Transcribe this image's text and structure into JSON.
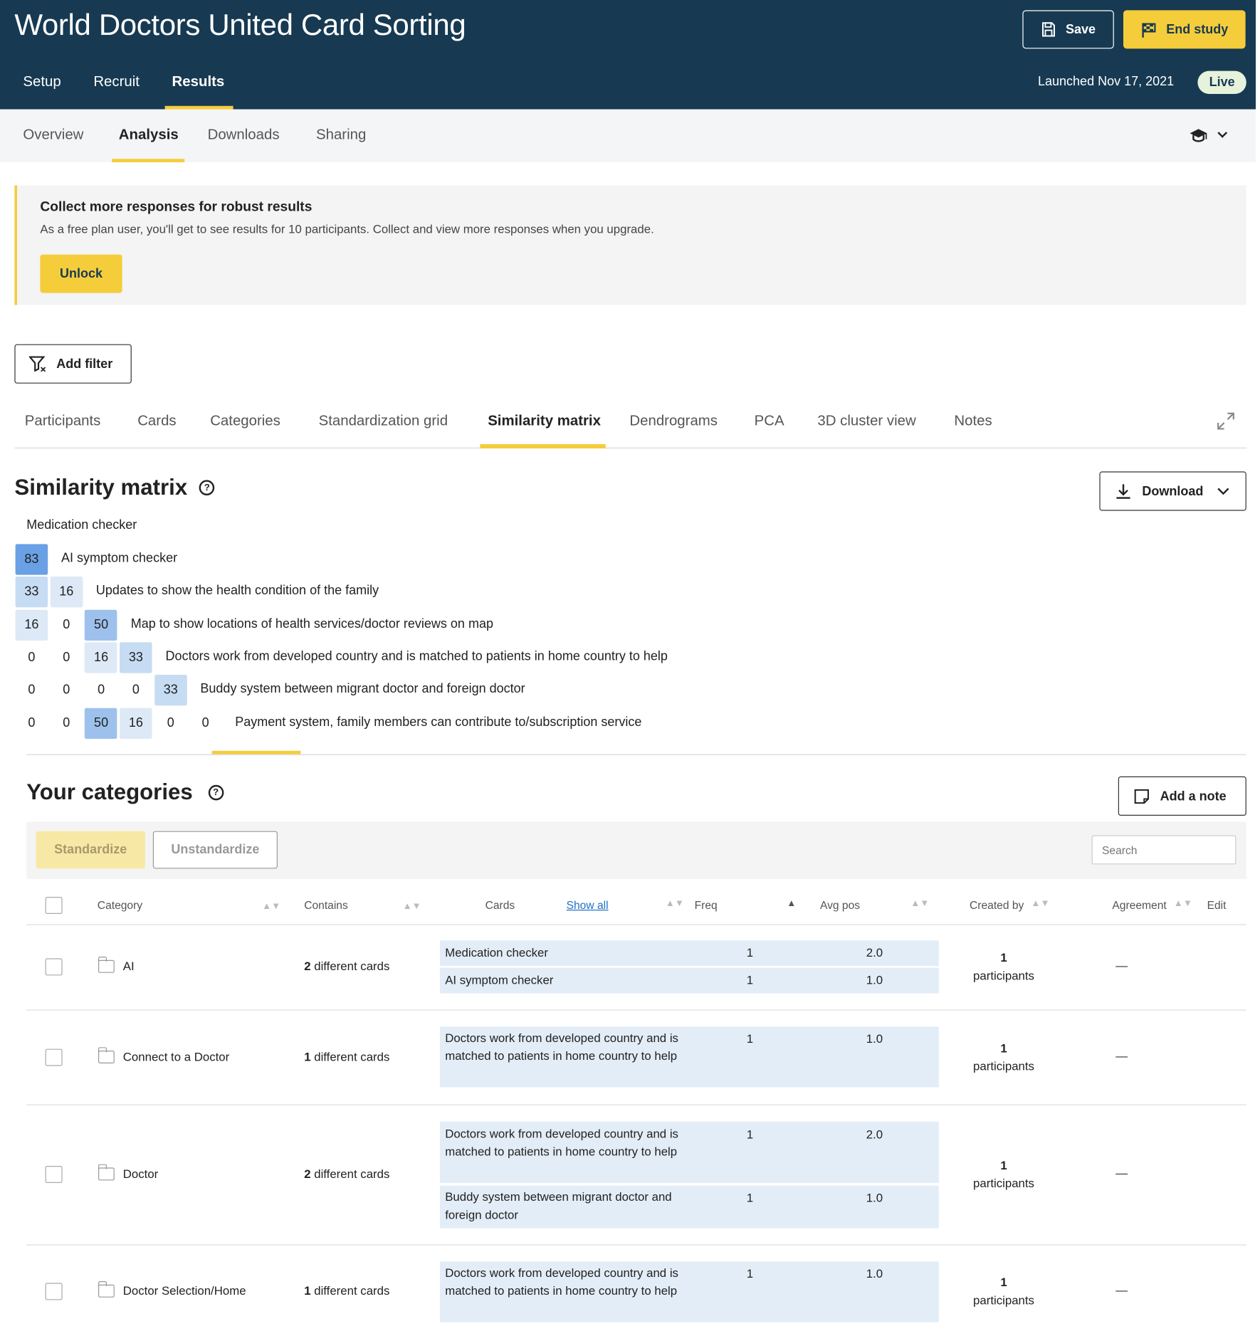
{
  "header": {
    "title": "World Doctors United Card Sorting",
    "save_label": "Save",
    "end_study_label": "End study",
    "launched": "Launched Nov 17, 2021",
    "status": "Live",
    "nav": [
      "Setup",
      "Recruit",
      "Results"
    ]
  },
  "subnav": {
    "items": [
      "Overview",
      "Analysis",
      "Downloads",
      "Sharing"
    ]
  },
  "banner": {
    "heading": "Collect more responses for robust results",
    "text": "As a free plan user, you'll get to see results for 10 participants. Collect and view more responses when you upgrade.",
    "button": "Unlock"
  },
  "filter": {
    "label": "Add filter"
  },
  "tabs": [
    "Participants",
    "Cards",
    "Categories",
    "Standardization grid",
    "Similarity matrix",
    "Dendrograms",
    "PCA",
    "3D cluster view",
    "Notes"
  ],
  "similarity": {
    "title": "Similarity matrix",
    "download_label": "Download",
    "labels": [
      "Medication checker",
      "AI symptom checker",
      "Updates to show the health condition of the family",
      "Map to show locations of health services/doctor reviews on map",
      "Doctors work from developed country and is matched to patients in home country to help",
      "Buddy system between migrant doctor and foreign doctor",
      "Payment system, family members can contribute to/subscription service"
    ],
    "rows": [
      [
        "83"
      ],
      [
        "33",
        "16"
      ],
      [
        "16",
        "0",
        "50"
      ],
      [
        "0",
        "0",
        "16",
        "33"
      ],
      [
        "0",
        "0",
        "0",
        "0",
        "33"
      ],
      [
        "0",
        "0",
        "50",
        "16",
        "0",
        "0"
      ]
    ]
  },
  "categories": {
    "title": "Your categories",
    "add_note_label": "Add a note",
    "standardize_label": "Standardize",
    "unstandardize_label": "Unstandardize",
    "search_placeholder": "Search",
    "columns": {
      "category": "Category",
      "contains": "Contains",
      "cards": "Cards",
      "show_all": "Show all",
      "freq": "Freq",
      "avg_pos": "Avg pos",
      "created_by": "Created by",
      "agreement": "Agreement",
      "edit": "Edit"
    },
    "rows": [
      {
        "name": "AI",
        "count": "2",
        "contains_suffix": "different cards",
        "cards": [
          {
            "text": "Medication checker",
            "freq": "1",
            "avg": "2.0"
          },
          {
            "text": "AI symptom checker",
            "freq": "1",
            "avg": "1.0"
          }
        ],
        "created_count": "1",
        "created_label": "participants",
        "agreement": "—"
      },
      {
        "name": "Connect to a Doctor",
        "count": "1",
        "contains_suffix": "different cards",
        "cards": [
          {
            "text": "Doctors work from developed country and is matched to patients in home country to help",
            "freq": "1",
            "avg": "1.0"
          }
        ],
        "created_count": "1",
        "created_label": "participants",
        "agreement": "—"
      },
      {
        "name": "Doctor",
        "count": "2",
        "contains_suffix": "different cards",
        "cards": [
          {
            "text": "Doctors work from developed country and is matched to patients in home country to help",
            "freq": "1",
            "avg": "2.0"
          },
          {
            "text": "Buddy system between migrant doctor and foreign doctor",
            "freq": "1",
            "avg": "1.0"
          }
        ],
        "created_count": "1",
        "created_label": "participants",
        "agreement": "—"
      },
      {
        "name": "Doctor Selection/Home",
        "count": "1",
        "contains_suffix": "different cards",
        "cards": [
          {
            "text": "Doctors work from developed country and is matched to patients in home country to help",
            "freq": "1",
            "avg": "1.0"
          }
        ],
        "created_count": "1",
        "created_label": "participants",
        "agreement": "—"
      }
    ]
  },
  "colors": {
    "header_bg": "#173a52",
    "accent": "#f5cd3b",
    "cell_low": "#dde9f6",
    "cell_mid": "#c6dcf3",
    "cell_high": "#9dc1ec",
    "cell_top": "#6aa1e6"
  }
}
